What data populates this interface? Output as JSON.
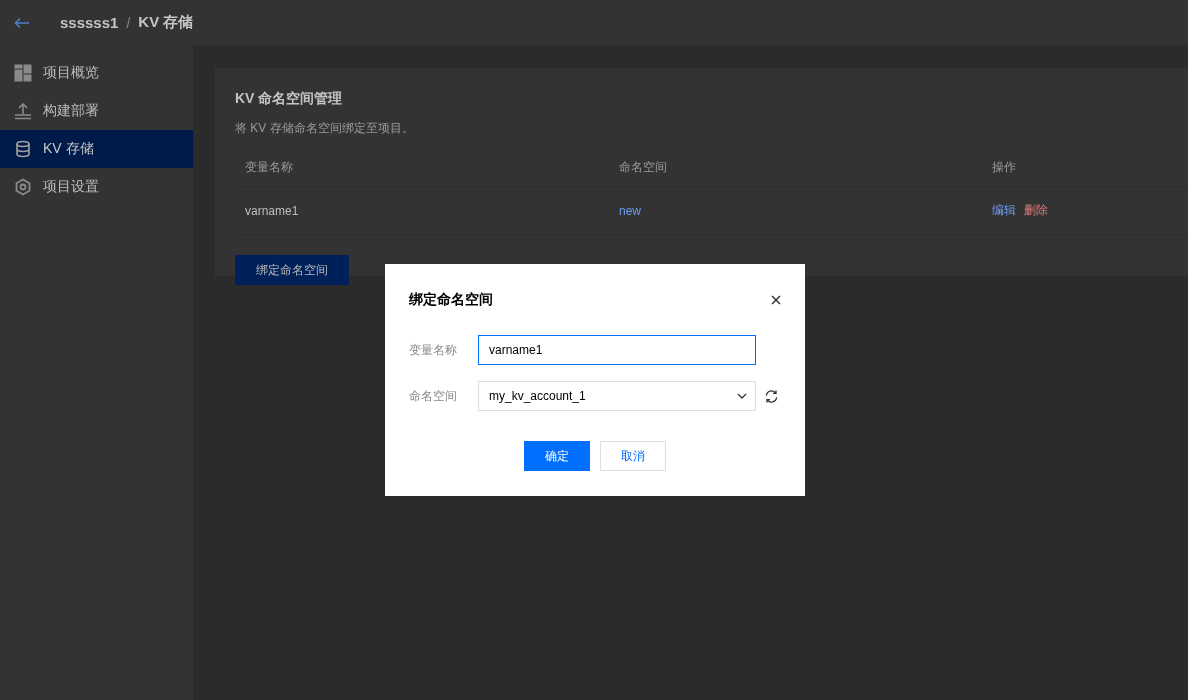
{
  "header": {
    "project": "ssssss1",
    "separator": "/",
    "page": "KV 存储"
  },
  "sidebar": {
    "items": [
      {
        "kind": "overview",
        "label": "项目概览",
        "selected": false
      },
      {
        "kind": "deploy",
        "label": "构建部署",
        "selected": false
      },
      {
        "kind": "storage",
        "label": "KV 存储",
        "selected": true
      },
      {
        "kind": "settings",
        "label": "项目设置",
        "selected": false
      }
    ]
  },
  "panel": {
    "title": "KV 命名空间管理",
    "description": "将 KV 存储命名空间绑定至项目。",
    "table": {
      "columns": [
        "变量名称",
        "命名空间",
        "操作"
      ],
      "rows": [
        {
          "variable": "varname1",
          "namespace": "new",
          "actions": [
            {
              "kind": "edit",
              "label": "编辑"
            },
            {
              "kind": "delete",
              "label": "删除"
            }
          ]
        }
      ]
    },
    "bind_button": "绑定命名空间"
  },
  "dialog": {
    "title": "绑定命名空间",
    "fields": [
      {
        "kind": "input",
        "label": "变量名称",
        "value": "varname1",
        "focused": true
      },
      {
        "kind": "select",
        "label": "命名空间",
        "value": "my_kv_account_1"
      }
    ],
    "buttons": [
      {
        "kind": "primary",
        "label": "确定"
      },
      {
        "kind": "secondary",
        "label": "取消"
      }
    ]
  }
}
